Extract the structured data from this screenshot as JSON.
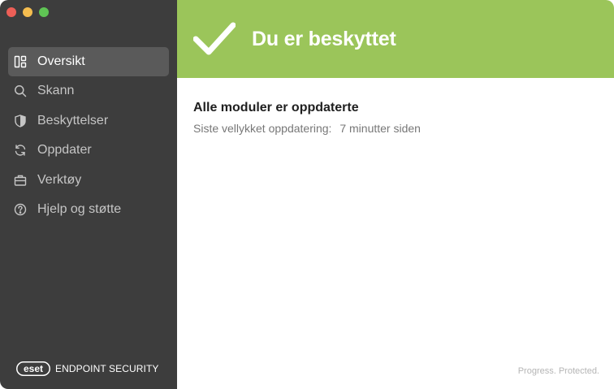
{
  "window": {
    "controls": [
      "close",
      "minimize",
      "zoom"
    ]
  },
  "sidebar": {
    "items": [
      {
        "label": "Oversikt",
        "icon": "dashboard-icon",
        "active": true
      },
      {
        "label": "Skann",
        "icon": "search-icon",
        "active": false
      },
      {
        "label": "Beskyttelser",
        "icon": "shield-icon",
        "active": false
      },
      {
        "label": "Oppdater",
        "icon": "refresh-icon",
        "active": false
      },
      {
        "label": "Verktøy",
        "icon": "toolbox-icon",
        "active": false
      },
      {
        "label": "Hjelp og støtte",
        "icon": "help-icon",
        "active": false
      }
    ],
    "brand": {
      "logo_text": "eset",
      "product": "ENDPOINT SECURITY"
    }
  },
  "main": {
    "banner": {
      "title": "Du er beskyttet",
      "color": "#9bc55a",
      "icon": "checkmark-icon"
    },
    "status": {
      "title": "Alle moduler er oppdaterte",
      "label": "Siste vellykket oppdatering:",
      "value": "7 minutter siden"
    },
    "footer": "Progress. Protected."
  },
  "colors": {
    "sidebar_bg": "#3d3d3d",
    "active_item_bg": "#5a5a5a",
    "accent_green": "#9bc55a"
  }
}
